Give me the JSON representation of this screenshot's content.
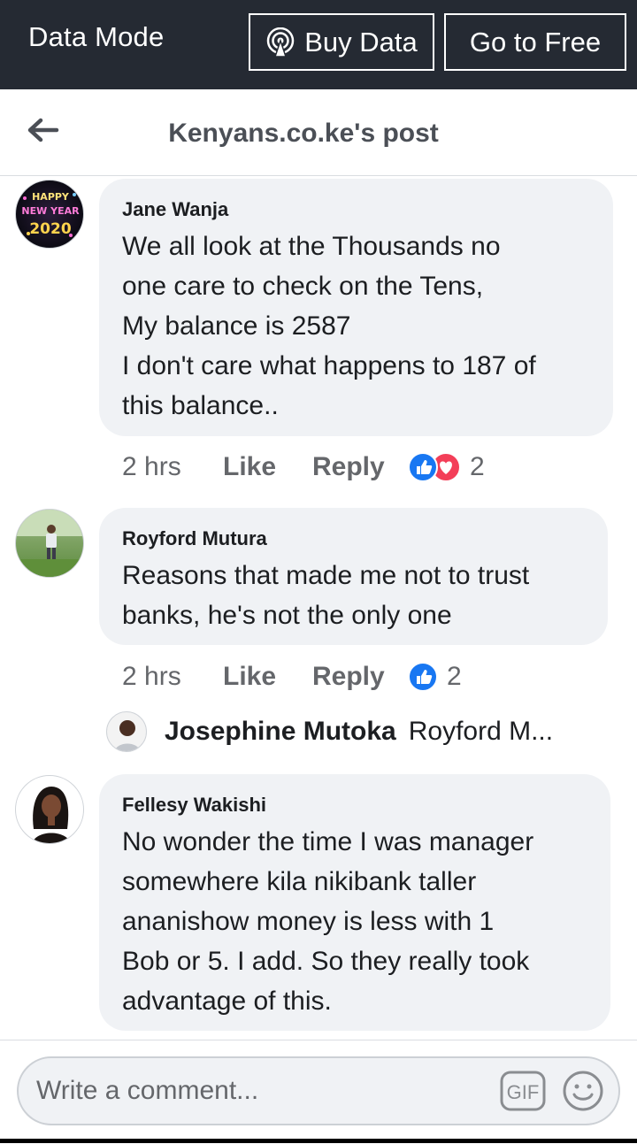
{
  "topbar": {
    "mode_label": "Data Mode",
    "buy_label": "Buy Data",
    "free_label": "Go to Free"
  },
  "header": {
    "title": "Kenyans.co.ke's post"
  },
  "comments": [
    {
      "author": "Jane Wanja",
      "text": "We all look at the Thousands no\none care to check on the Tens,\nMy balance is 2587\nI don't care what happens to 187 of\nthis balance..",
      "avatar_text": [
        "HAPPY",
        "NEW YEAR",
        "2020"
      ],
      "time": "2 hrs",
      "like_label": "Like",
      "reply_label": "Reply",
      "reactions": [
        "like-icon",
        "love-icon"
      ],
      "reaction_count": "2"
    },
    {
      "author": "Royford Mutura",
      "text": "Reasons that made me not to trust\nbanks, he's not the only one",
      "time": "2 hrs",
      "like_label": "Like",
      "reply_label": "Reply",
      "reactions": [
        "like-icon"
      ],
      "reaction_count": "2",
      "reply_preview": {
        "name": "Josephine Mutoka",
        "snippet": "Royford M..."
      }
    },
    {
      "author": "Fellesy Wakishi",
      "text": "No wonder the time I was manager\nsomewhere kila nikibank taller\nananishow money is less with 1\nBob or 5. I add. So they really took\nadvantage of this."
    }
  ],
  "composer": {
    "placeholder": "Write a comment...",
    "gif_label": "GIF"
  },
  "colors": {
    "topbar_bg": "#252a33",
    "bubble_bg": "#f0f2f5",
    "like_blue": "#1877f2",
    "love_red": "#f33e58",
    "meta_grey": "#65676b"
  }
}
